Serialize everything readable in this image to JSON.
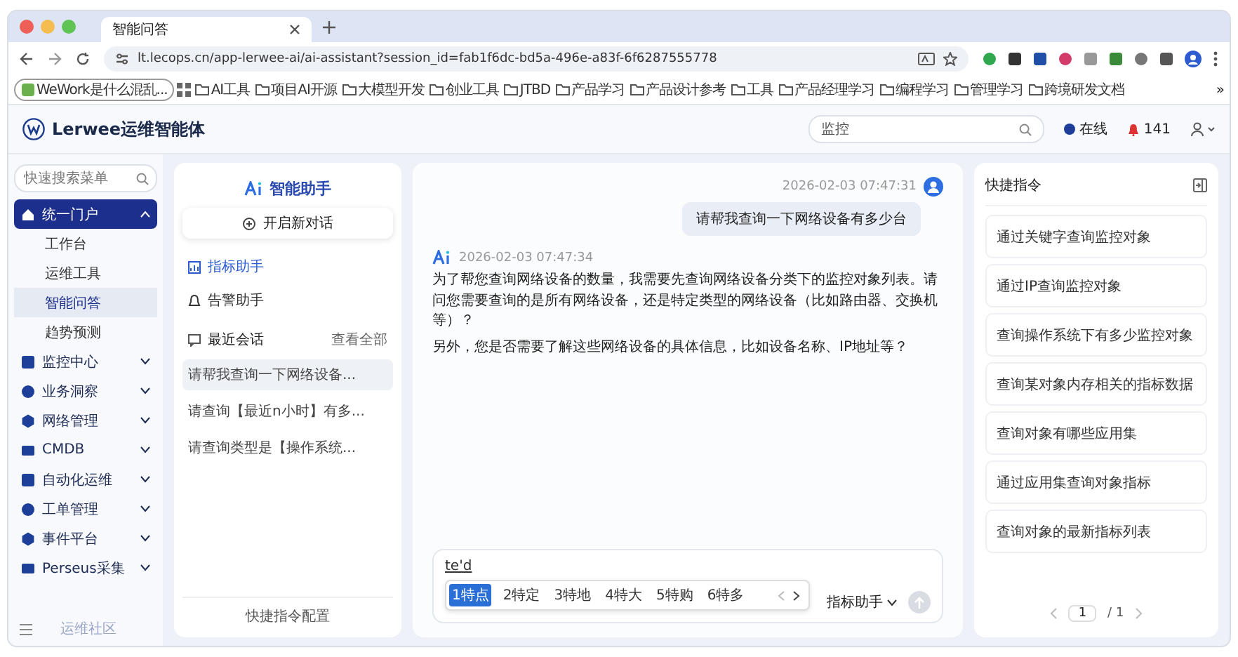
{
  "browser": {
    "tab_title": "智能问答",
    "url": "lt.lecops.cn/app-lerwee-ai/ai-assistant?session_id=fab1f6dc-bd5a-496e-a83f-6f6287555778",
    "bookmarks": [
      {
        "kind": "page",
        "label": "WeWork是什么混乱..."
      },
      {
        "kind": "apps"
      },
      {
        "kind": "folder",
        "label": "AI工具"
      },
      {
        "kind": "folder",
        "label": "项目AI开源"
      },
      {
        "kind": "folder",
        "label": "大模型开发"
      },
      {
        "kind": "folder",
        "label": "创业工具"
      },
      {
        "kind": "folder",
        "label": "JTBD"
      },
      {
        "kind": "folder",
        "label": "产品学习"
      },
      {
        "kind": "folder",
        "label": "产品设计参考"
      },
      {
        "kind": "folder",
        "label": "工具"
      },
      {
        "kind": "folder",
        "label": "产品经理学习"
      },
      {
        "kind": "folder",
        "label": "编程学习"
      },
      {
        "kind": "folder",
        "label": "管理学习"
      },
      {
        "kind": "folder",
        "label": "跨境研发文档"
      }
    ],
    "bookmarks_overflow": "»"
  },
  "app_header": {
    "brand": "Lerwee运维智能体",
    "search_value": "监控",
    "status_label": "在线",
    "alert_count": "141"
  },
  "sidebar": {
    "search_placeholder": "快速搜索菜单",
    "items": [
      {
        "label": "统一门户",
        "selected": true,
        "expanded": true,
        "children": [
          {
            "label": "工作台",
            "selected": false
          },
          {
            "label": "运维工具",
            "selected": false
          },
          {
            "label": "智能问答",
            "selected": true
          },
          {
            "label": "趋势预测",
            "selected": false
          }
        ]
      },
      {
        "label": "监控中心",
        "selected": false,
        "expanded": false
      },
      {
        "label": "业务洞察",
        "selected": false,
        "expanded": false
      },
      {
        "label": "网络管理",
        "selected": false,
        "expanded": false
      },
      {
        "label": "CMDB",
        "selected": false,
        "expanded": false
      },
      {
        "label": "自动化运维",
        "selected": false,
        "expanded": false
      },
      {
        "label": "工单管理",
        "selected": false,
        "expanded": false
      },
      {
        "label": "事件平台",
        "selected": false,
        "expanded": false
      },
      {
        "label": "Perseus采集",
        "selected": false,
        "expanded": false
      }
    ],
    "footer": "运维社区"
  },
  "assistant_panel": {
    "title": "智能助手",
    "new_chat": "开启新对话",
    "agents": [
      {
        "label": "指标助手",
        "selected": true
      },
      {
        "label": "告警助手",
        "selected": false
      }
    ],
    "recent_title": "最近会话",
    "view_all": "查看全部",
    "recent": [
      {
        "label": "请帮我查询一下网络设备...",
        "selected": true
      },
      {
        "label": "请查询【最近n小时】有多...",
        "selected": false
      },
      {
        "label": "请查询类型是【操作系统...",
        "selected": false
      }
    ],
    "footer": "快捷指令配置"
  },
  "chat": {
    "messages": [
      {
        "kind": "user",
        "time": "2026-02-03 07:47:31",
        "paragraphs": [
          "请帮我查询一下网络设备有多少台"
        ]
      },
      {
        "kind": "assistant",
        "time": "2026-02-03 07:47:34",
        "paragraphs": [
          "为了帮您查询网络设备的数量，我需要先查询网络设备分类下的监控对象列表。请问您需要查询的是所有网络设备，还是特定类型的网络设备（比如路由器、交换机等）？",
          "另外，您是否需要了解这些网络设备的具体信息，比如设备名称、IP地址等？"
        ]
      }
    ],
    "input": {
      "value": "te'd",
      "candidates": [
        {
          "label": "1特点",
          "selected": true
        },
        {
          "label": "2特定",
          "selected": false
        },
        {
          "label": "3特地",
          "selected": false
        },
        {
          "label": "4特大",
          "selected": false
        },
        {
          "label": "5特购",
          "selected": false
        },
        {
          "label": "6特多",
          "selected": false
        }
      ],
      "agent_select": "指标助手",
      "send_disabled": true
    }
  },
  "quick_commands": {
    "title": "快捷指令",
    "items": [
      "通过关键字查询监控对象",
      "通过IP查询监控对象",
      "查询操作系统下有多少监控对象",
      "查询某对象内存相关的指标数据",
      "查询对象有哪些应用集",
      "通过应用集查询对象指标",
      "查询对象的最新指标列表"
    ],
    "page_current": "1",
    "page_total": "/ 1"
  }
}
